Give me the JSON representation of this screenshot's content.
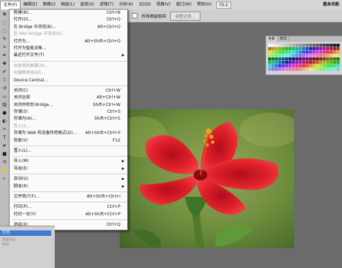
{
  "menubar": {
    "items": [
      "文件(F)",
      "编辑(E)",
      "图像(I)",
      "图层(L)",
      "选择(S)",
      "滤镜(T)",
      "分析(A)",
      "3D(D)",
      "视图(V)",
      "窗口(W)",
      "帮助(H)"
    ],
    "zoom": "75.1",
    "workspace": "基本功能"
  },
  "options_bar": {
    "checkbox_label": "所有图层取样",
    "refine_button": "调整边缘..."
  },
  "file_menu": {
    "rows": [
      {
        "label": "新建(N)...",
        "shortcut": "Ctrl+N"
      },
      {
        "label": "打开(O)...",
        "shortcut": "Ctrl+O"
      },
      {
        "label": "在 Bridge 中浏览(B)...",
        "shortcut": "Alt+Ctrl+O"
      },
      {
        "label": "在 Mini Bridge 中浏览(G)...",
        "shortcut": ""
      },
      {
        "label": "打开为...",
        "shortcut": "Alt+Shift+Ctrl+O"
      },
      {
        "label": "打开为智能对象...",
        "shortcut": ""
      },
      {
        "label": "最近打开文件(T)",
        "shortcut": ""
      },
      {
        "label": "共享我的屏幕(H)...",
        "shortcut": ""
      },
      {
        "label": "创建新审阅(W)...",
        "shortcut": ""
      },
      {
        "label": "Device Central...",
        "shortcut": ""
      },
      {
        "label": "关闭(C)",
        "shortcut": "Ctrl+W"
      },
      {
        "label": "关闭全部",
        "shortcut": "Alt+Ctrl+W"
      },
      {
        "label": "关闭并转到 Bridge...",
        "shortcut": "Shift+Ctrl+W"
      },
      {
        "label": "存储(S)",
        "shortcut": "Ctrl+S"
      },
      {
        "label": "存储为(A)...",
        "shortcut": "Shift+Ctrl+S"
      },
      {
        "label": "签入(I)...",
        "shortcut": ""
      },
      {
        "label": "存储为 Web 和设备所用格式(D)...",
        "shortcut": "Alt+Shift+Ctrl+S"
      },
      {
        "label": "恢复(V)",
        "shortcut": "F12"
      },
      {
        "label": "置入(L)...",
        "shortcut": ""
      },
      {
        "label": "导入(M)",
        "shortcut": ""
      },
      {
        "label": "导出(E)",
        "shortcut": ""
      },
      {
        "label": "自动(U)",
        "shortcut": ""
      },
      {
        "label": "脚本(R)",
        "shortcut": ""
      },
      {
        "label": "文件简介(F)...",
        "shortcut": "Alt+Shift+Ctrl+I"
      },
      {
        "label": "打印(P)...",
        "shortcut": "Ctrl+P"
      },
      {
        "label": "打印一份(Y)",
        "shortcut": "Alt+Shift+Ctrl+P"
      },
      {
        "label": "退出(X)",
        "shortcut": "Ctrl+Q"
      }
    ]
  },
  "swatches_panel": {
    "tabs": [
      "色板",
      "样式"
    ]
  },
  "lower_panel": {
    "selected": "打开",
    "items": [
      "通道混合",
      "色相"
    ]
  },
  "colors": {
    "menu_bg": "#fafafa",
    "selection_blue": "#3d7bd0",
    "flower_red": "#e0202a",
    "background_green": "#6f8f3e"
  }
}
